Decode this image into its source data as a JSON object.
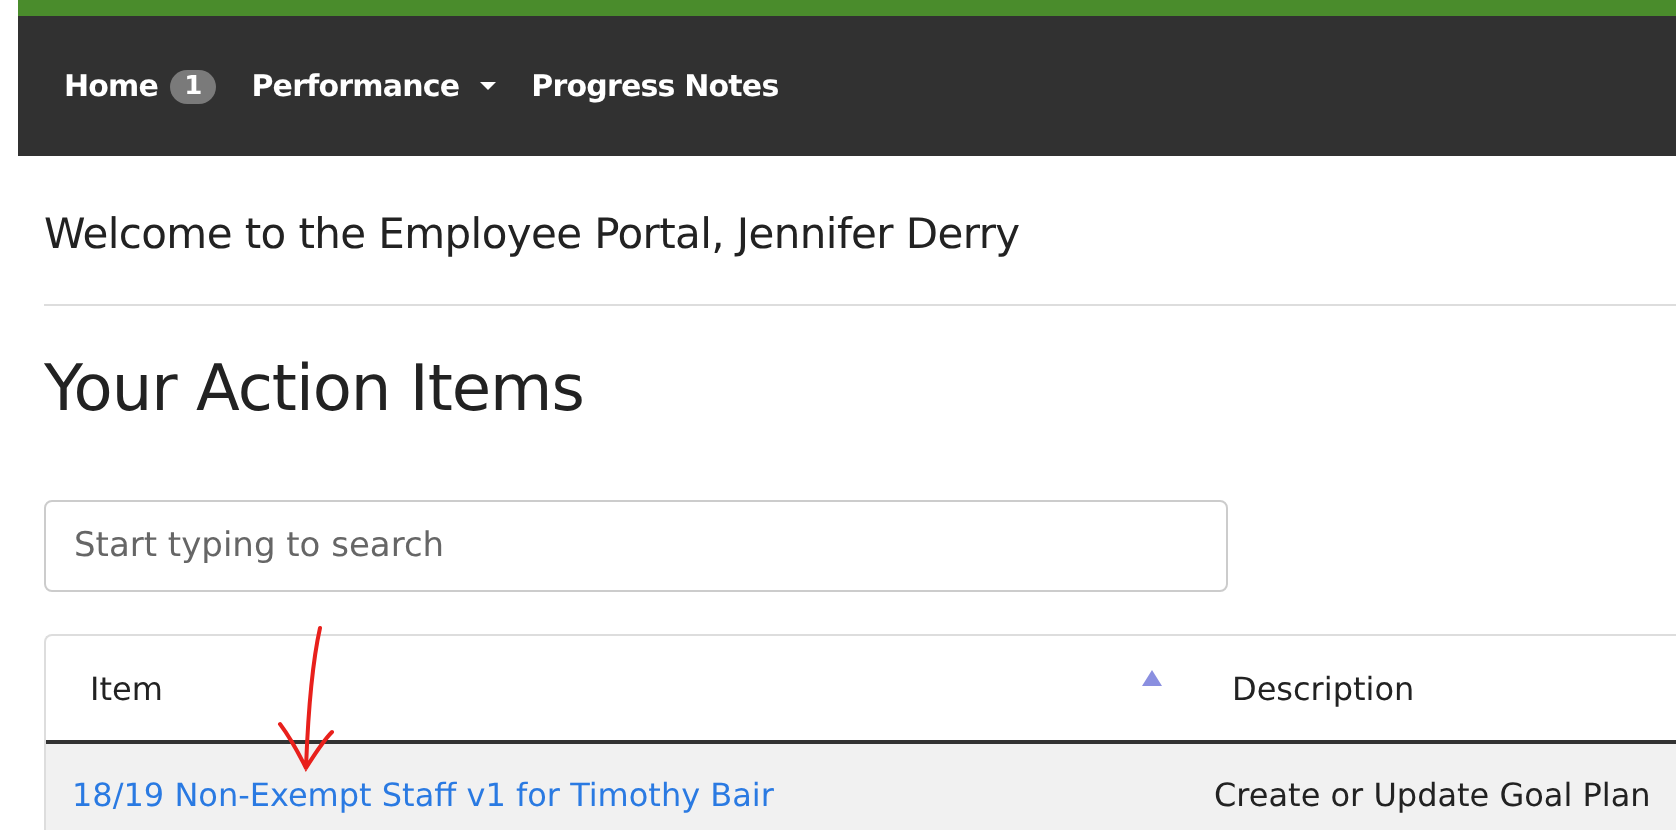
{
  "nav": [
    {
      "label": "Home",
      "badge": "1",
      "dropdown": false
    },
    {
      "label": "Performance",
      "dropdown": true
    },
    {
      "label": "Progress Notes",
      "dropdown": false
    }
  ],
  "welcome": "Welcome to the Employee Portal, Jennifer Derry",
  "heading": "Your Action Items",
  "search": {
    "placeholder": "Start typing to search"
  },
  "table": {
    "columns": [
      {
        "label": "Item",
        "sorted": true
      },
      {
        "label": "Description",
        "sorted": false
      }
    ],
    "rows": [
      {
        "item": "18/19 Non-Exempt Staff v1 for Timothy Bair",
        "description": "Create or Update Goal Plan"
      }
    ]
  }
}
